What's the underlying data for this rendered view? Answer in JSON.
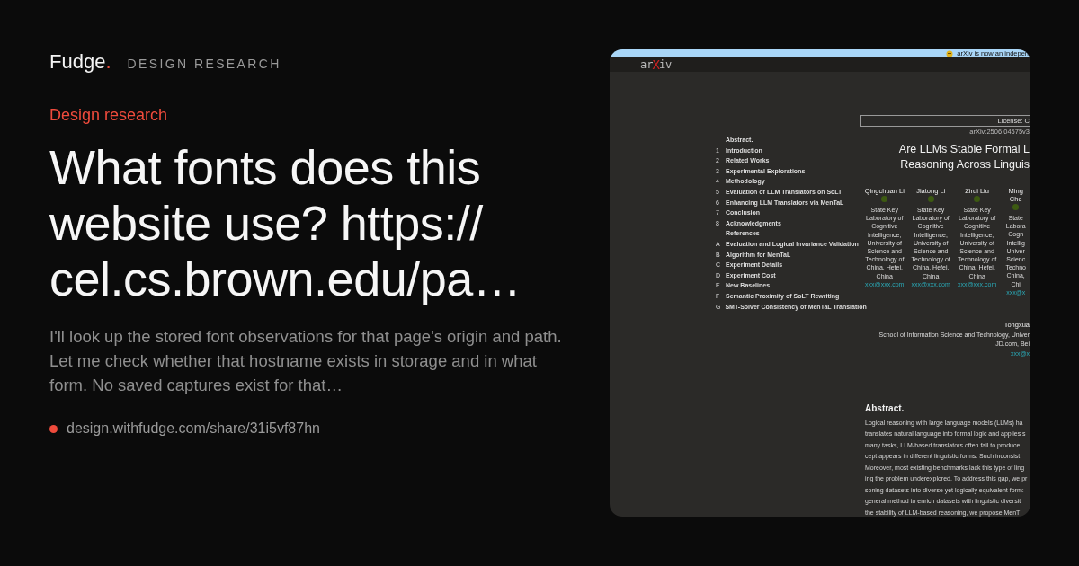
{
  "brand": {
    "name": "Fudge",
    "dot": ".",
    "section": "DESIGN RESEARCH"
  },
  "category": "Design research",
  "heading": "What fonts does this website use? https://cel.cs.brown.edu/pa…",
  "summary": "I'll look up the stored font observations for that page's origin and path. Let me check whether that hostname exists in storage and in what form. No saved captures exist for that…",
  "share_link": "design.withfudge.com/share/31i5vf87hn",
  "screenshot": {
    "banner": "arXiv is now an indepen",
    "logo": {
      "left": "ar",
      "mark": "X",
      "right": "iv"
    },
    "toc": [
      {
        "label": "Abstract."
      },
      {
        "number": "1",
        "label": "Introduction"
      },
      {
        "number": "2",
        "label": "Related Works"
      },
      {
        "number": "3",
        "label": "Experimental Explorations"
      },
      {
        "number": "4",
        "label": "Methodology"
      },
      {
        "number": "5",
        "label": "Evaluation of LLM Translators on SoLT"
      },
      {
        "number": "6",
        "label": "Enhancing LLM Translators via MenTaL"
      },
      {
        "number": "7",
        "label": "Conclusion"
      },
      {
        "number": "8",
        "label": "Acknowledgments"
      },
      {
        "label": "References"
      },
      {
        "number": "A",
        "label": "Evaluation and Logical Invariance Validation"
      },
      {
        "number": "B",
        "label": "Algorithm for MenTaL"
      },
      {
        "number": "C",
        "label": "Experiment Details"
      },
      {
        "number": "D",
        "label": "Experiment Cost"
      },
      {
        "number": "E",
        "label": "New Baselines"
      },
      {
        "number": "F",
        "label": "Semantic Proximity of SoLT Rewriting"
      },
      {
        "number": "G",
        "label": "SMT-Solver Consistency of MenTaL Translation"
      }
    ],
    "license": "License: C",
    "arxiv_id": "arXiv:2506.04575v3",
    "title_lines": [
      "Are LLMs Stable Formal L",
      "Reasoning Across Linguis"
    ],
    "authors": [
      {
        "name_lines": [
          "Qingchuan Li"
        ],
        "affiliation_lines": [
          "State Key",
          "Laboratory of",
          "Cognitive",
          "Intelligence,",
          "University of",
          "Science and",
          "Technology of",
          "China, Hefei,",
          "China"
        ],
        "email": "xxx@xxx.com"
      },
      {
        "name_lines": [
          "Jiatong Li"
        ],
        "affiliation_lines": [
          "State Key",
          "Laboratory of",
          "Cognitive",
          "Intelligence,",
          "University of",
          "Science and",
          "Technology of",
          "China, Hefei,",
          "China"
        ],
        "email": "xxx@xxx.com"
      },
      {
        "name_lines": [
          "Zirui Liu"
        ],
        "affiliation_lines": [
          "State Key",
          "Laboratory of",
          "Cognitive",
          "Intelligence,",
          "University of",
          "Science and",
          "Technology of",
          "China, Hefei,",
          "China"
        ],
        "email": "xxx@xxx.com"
      },
      {
        "name_lines": [
          "Ming",
          "Che"
        ],
        "affiliation_lines": [
          "State",
          "Labora",
          "Cogn",
          "Intellig",
          "Univer",
          "Scienc",
          "Techno",
          "China,",
          "Chi"
        ],
        "email": "xxx@x"
      }
    ],
    "second_author": {
      "name": "Tongxua",
      "affiliation": "School of Information Science and Technology, Univer",
      "company": "JD.com, Bei",
      "email": "xxx@x"
    },
    "abstract_heading": "Abstract.",
    "abstract_lines": [
      "Logical reasoning with large language models (LLMs) ha",
      "translates natural language into formal logic and applies s",
      "many tasks, LLM-based translators often fail to produce",
      "cept appears in different linguistic forms. Such inconsist",
      "Moreover, most existing benchmarks lack this type of ling",
      "ing the problem underexplored. To address this gap, we pr",
      "soning datasets into diverse yet logically equivalent form:",
      "general method to enrich datasets with linguistic diversit",
      "the stability of LLM-based reasoning, we propose MenT"
    ]
  }
}
